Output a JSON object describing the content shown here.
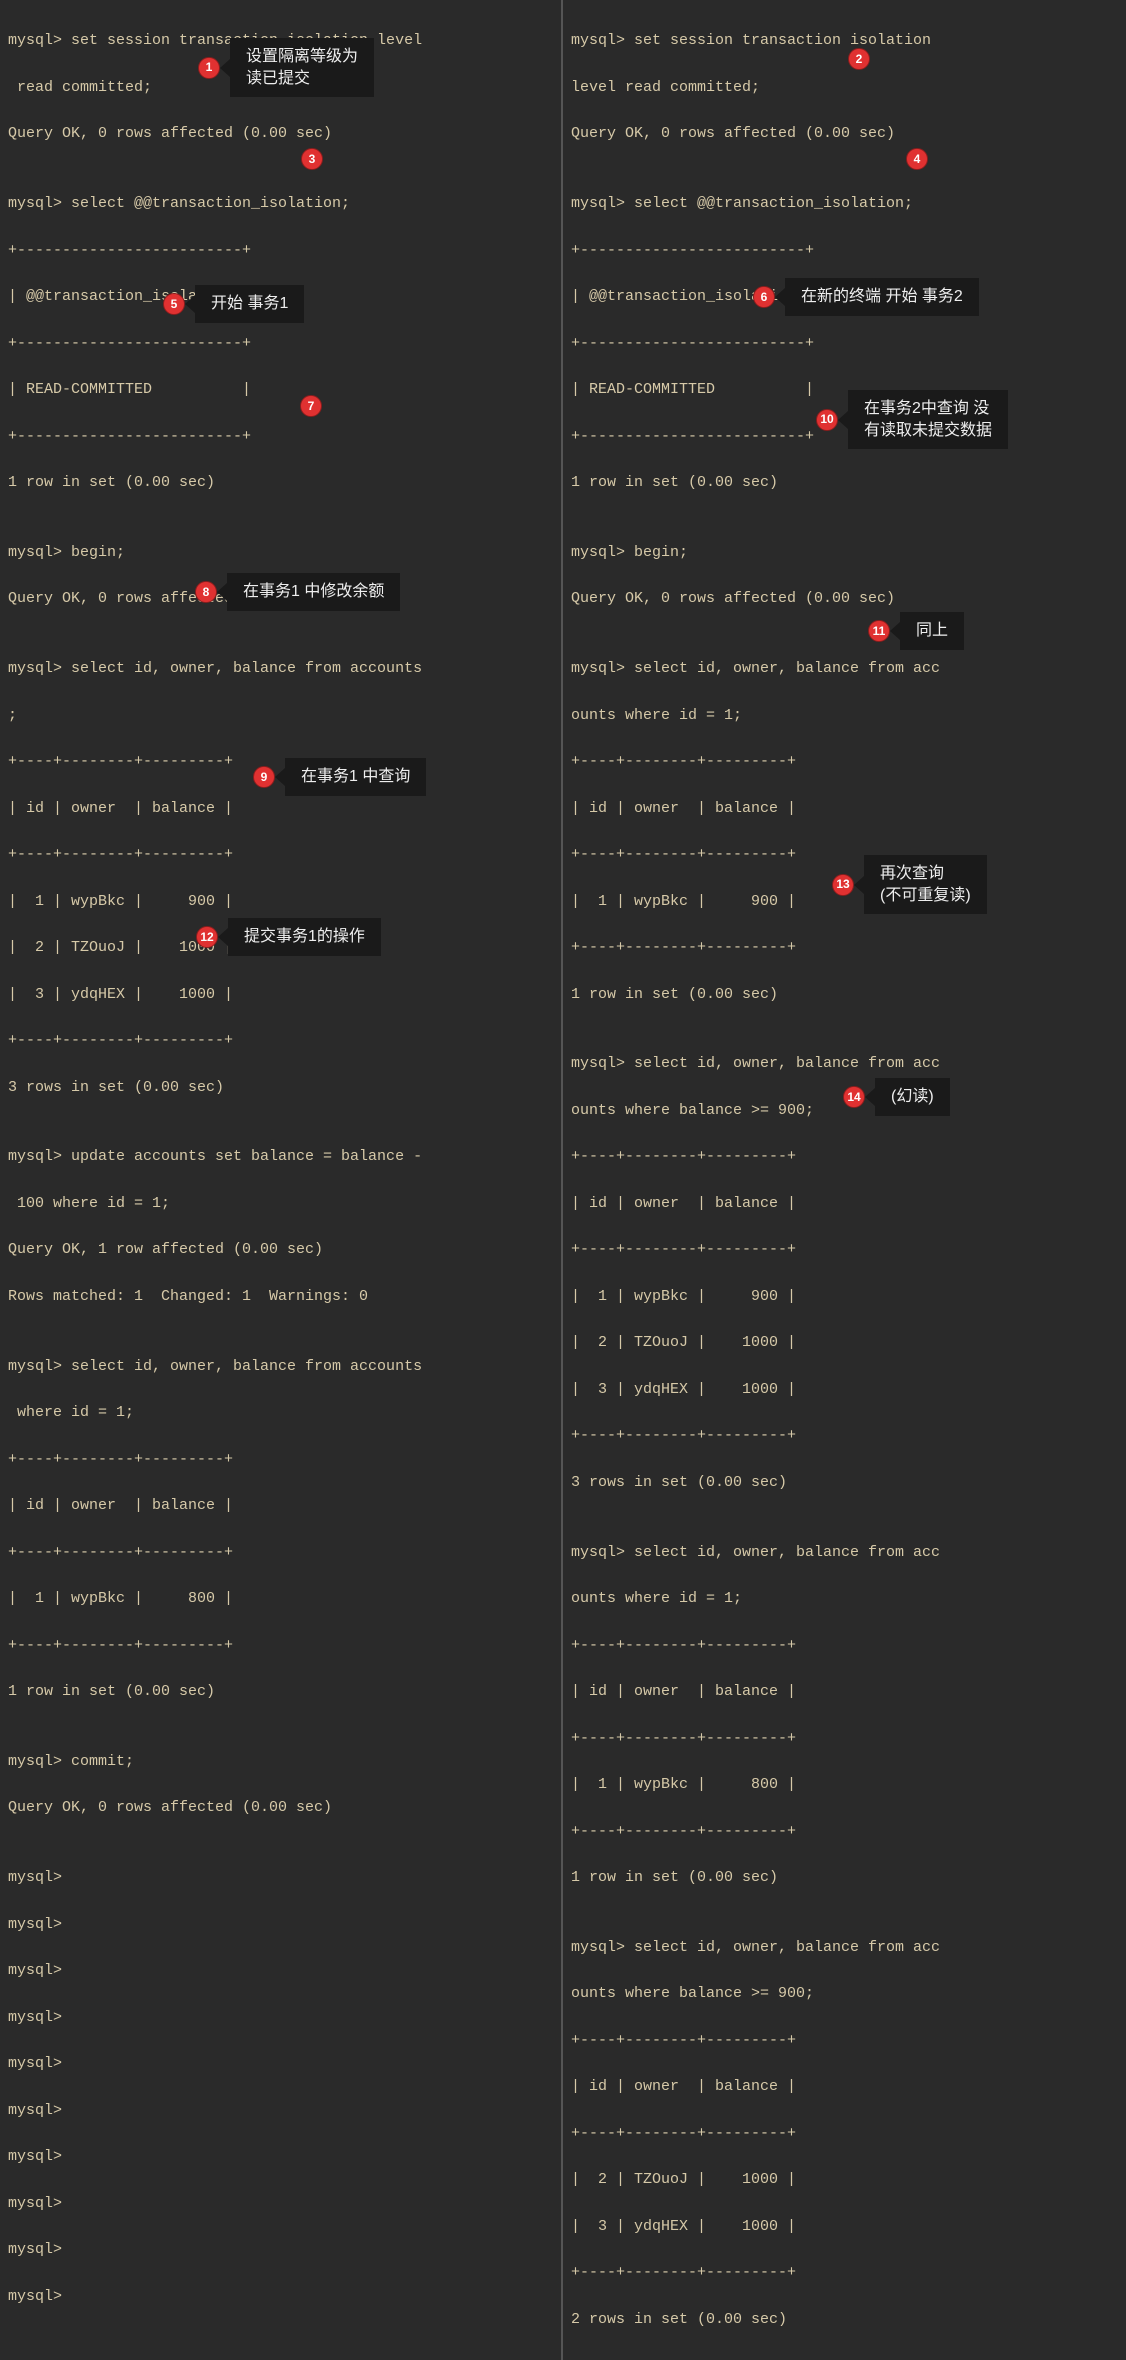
{
  "left": {
    "l1": "mysql> set session transaction isolation level",
    "l2": " read committed;",
    "l3": "Query OK, 0 rows affected (0.00 sec)",
    "l4": "",
    "l5": "mysql> select @@transaction_isolation;",
    "l6": "+-------------------------+",
    "l7": "| @@transaction_isolation |",
    "l8": "+-------------------------+",
    "l9": "| READ-COMMITTED          |",
    "l10": "+-------------------------+",
    "l11": "1 row in set (0.00 sec)",
    "l12": "",
    "l13": "mysql> begin;",
    "l14": "Query OK, 0 rows affected (0.00 sec)",
    "l15": "",
    "l16": "mysql> select id, owner, balance from accounts",
    "l17": ";",
    "l18": "+----+--------+---------+",
    "l19": "| id | owner  | balance |",
    "l20": "+----+--------+---------+",
    "l21": "|  1 | wypBkc |     900 |",
    "l22": "|  2 | TZOuoJ |    1000 |",
    "l23": "|  3 | ydqHEX |    1000 |",
    "l24": "+----+--------+---------+",
    "l25": "3 rows in set (0.00 sec)",
    "l26": "",
    "l27": "mysql> update accounts set balance = balance -",
    "l28": " 100 where id = 1;",
    "l29": "Query OK, 1 row affected (0.00 sec)",
    "l30": "Rows matched: 1  Changed: 1  Warnings: 0",
    "l31": "",
    "l32": "mysql> select id, owner, balance from accounts",
    "l33": " where id = 1;",
    "l34": "+----+--------+---------+",
    "l35": "| id | owner  | balance |",
    "l36": "+----+--------+---------+",
    "l37": "|  1 | wypBkc |     800 |",
    "l38": "+----+--------+---------+",
    "l39": "1 row in set (0.00 sec)",
    "l40": "",
    "l41": "mysql> commit;",
    "l42": "Query OK, 0 rows affected (0.00 sec)",
    "l43": "",
    "l44": "mysql>",
    "l45": "mysql>",
    "l46": "mysql>",
    "l47": "mysql>",
    "l48": "mysql>",
    "l49": "mysql>",
    "l50": "mysql>",
    "l51": "mysql>",
    "l52": "mysql>",
    "l53": "mysql>"
  },
  "right": {
    "r1": "mysql> set session transaction isolation ",
    "r2": "level read committed;",
    "r3": "Query OK, 0 rows affected (0.00 sec)",
    "r4": "",
    "r5": "mysql> select @@transaction_isolation;",
    "r6": "+-------------------------+",
    "r7": "| @@transaction_isolation |",
    "r8": "+-------------------------+",
    "r9": "| READ-COMMITTED          |",
    "r10": "+-------------------------+",
    "r11": "1 row in set (0.00 sec)",
    "r12": "",
    "r13": "mysql> begin;",
    "r14": "Query OK, 0 rows affected (0.00 sec)",
    "r15": "",
    "r16": "mysql> select id, owner, balance from acc",
    "r17": "ounts where id = 1;",
    "r18": "+----+--------+---------+",
    "r19": "| id | owner  | balance |",
    "r20": "+----+--------+---------+",
    "r21": "|  1 | wypBkc |     900 |",
    "r22": "+----+--------+---------+",
    "r23": "1 row in set (0.00 sec)",
    "r24": "",
    "r25": "mysql> select id, owner, balance from acc",
    "r26": "ounts where balance >= 900;",
    "r27": "+----+--------+---------+",
    "r28": "| id | owner  | balance |",
    "r29": "+----+--------+---------+",
    "r30": "|  1 | wypBkc |     900 |",
    "r31": "|  2 | TZOuoJ |    1000 |",
    "r32": "|  3 | ydqHEX |    1000 |",
    "r33": "+----+--------+---------+",
    "r34": "3 rows in set (0.00 sec)",
    "r35": "",
    "r36": "mysql> select id, owner, balance from acc",
    "r37": "ounts where id = 1;",
    "r38": "+----+--------+---------+",
    "r39": "| id | owner  | balance |",
    "r40": "+----+--------+---------+",
    "r41": "|  1 | wypBkc |     800 |",
    "r42": "+----+--------+---------+",
    "r43": "1 row in set (0.00 sec)",
    "r44": "",
    "r45": "mysql> select id, owner, balance from acc",
    "r46": "ounts where balance >= 900;",
    "r47": "+----+--------+---------+",
    "r48": "| id | owner  | balance |",
    "r49": "+----+--------+---------+",
    "r50": "|  2 | TZOuoJ |    1000 |",
    "r51": "|  3 | ydqHEX |    1000 |",
    "r52": "+----+--------+---------+",
    "r53": "2 rows in set (0.00 sec)"
  },
  "annotations": {
    "a1": {
      "num": "1",
      "text": "设置隔离等级为\n读已提交"
    },
    "a2": {
      "num": "2",
      "text": ""
    },
    "a3": {
      "num": "3",
      "text": ""
    },
    "a4": {
      "num": "4",
      "text": ""
    },
    "a5": {
      "num": "5",
      "text": "开始 事务1"
    },
    "a6": {
      "num": "6",
      "text": "在新的终端 开始 事务2"
    },
    "a7": {
      "num": "7",
      "text": ""
    },
    "a8": {
      "num": "8",
      "text": "在事务1 中修改余额"
    },
    "a9": {
      "num": "9",
      "text": "在事务1 中查询"
    },
    "a10": {
      "num": "10",
      "text": "在事务2中查询 没\n有读取未提交数据"
    },
    "a11": {
      "num": "11",
      "text": "同上"
    },
    "a12": {
      "num": "12",
      "text": "提交事务1的操作"
    },
    "a13": {
      "num": "13",
      "text": "再次查询\n(不可重复读)"
    },
    "a14": {
      "num": "14",
      "text": "(幻读)"
    }
  }
}
